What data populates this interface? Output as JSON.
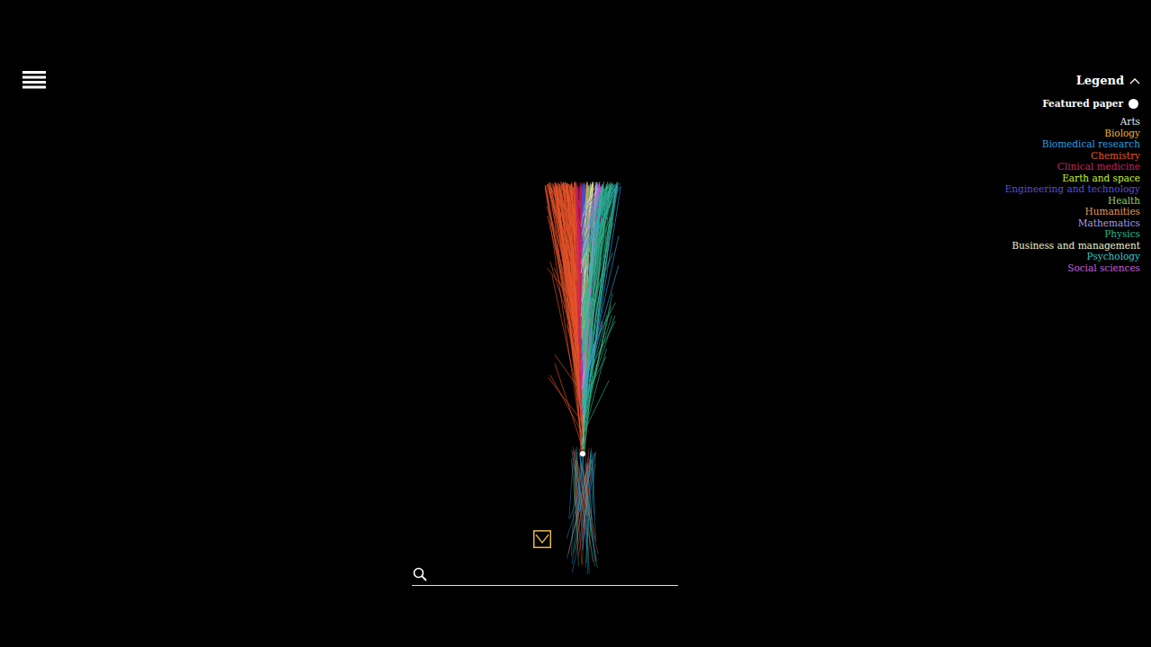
{
  "legend": {
    "title": "Legend",
    "expanded": true,
    "featured": {
      "label": "Featured paper",
      "color": "#ffffff"
    },
    "categories": [
      {
        "name": "Arts",
        "color": "#e6e6e6"
      },
      {
        "name": "Biology",
        "color": "#f2b230"
      },
      {
        "name": "Biomedical research",
        "color": "#2e9fe0"
      },
      {
        "name": "Chemistry",
        "color": "#e8552c"
      },
      {
        "name": "Clinical medicine",
        "color": "#c8215e"
      },
      {
        "name": "Earth and space",
        "color": "#c6f03a"
      },
      {
        "name": "Engineering and technology",
        "color": "#5b4fd8"
      },
      {
        "name": "Health",
        "color": "#8fd16a"
      },
      {
        "name": "Humanities",
        "color": "#e39b5b"
      },
      {
        "name": "Mathematics",
        "color": "#a89ce8"
      },
      {
        "name": "Physics",
        "color": "#2fb68c"
      },
      {
        "name": "Business and management",
        "color": "#eef0c8"
      },
      {
        "name": "Psychology",
        "color": "#35c6c6"
      },
      {
        "name": "Social sciences",
        "color": "#cc5fd6"
      }
    ]
  },
  "search": {
    "placeholder": ""
  }
}
